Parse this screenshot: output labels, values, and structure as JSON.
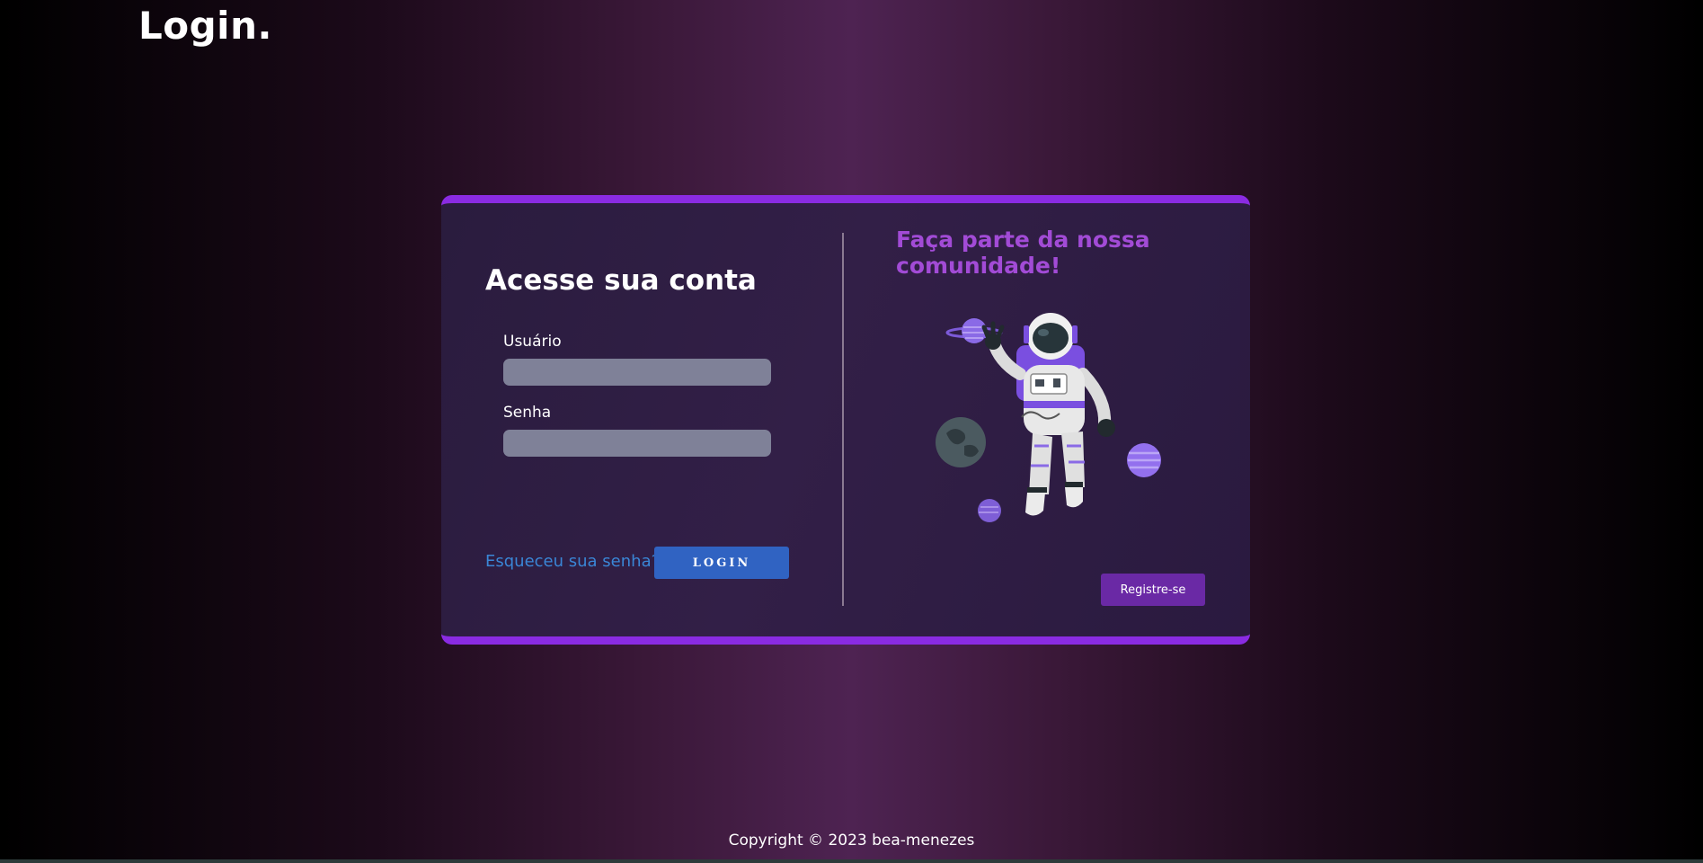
{
  "header": {
    "title": "Login."
  },
  "login": {
    "heading": "Acesse sua conta",
    "username_label": "Usuário",
    "username_value": "",
    "password_label": "Senha",
    "password_value": "",
    "forgot_link": "Esqueceu sua senha?",
    "login_button": "LOGIN"
  },
  "promo": {
    "heading": "Faça parte da nossa comunidade!",
    "register_button": "Registre-se",
    "illustration_icon": "astronaut-illustration"
  },
  "footer": {
    "copyright": "Copyright © 2023 bea-menezes"
  },
  "colors": {
    "accent": "#8a2be2",
    "promo_heading": "#a24bd6",
    "login_button": "#3063c2",
    "register_button": "#6a29a5",
    "link": "#3a86d6",
    "input_bg": "#7f8198"
  }
}
